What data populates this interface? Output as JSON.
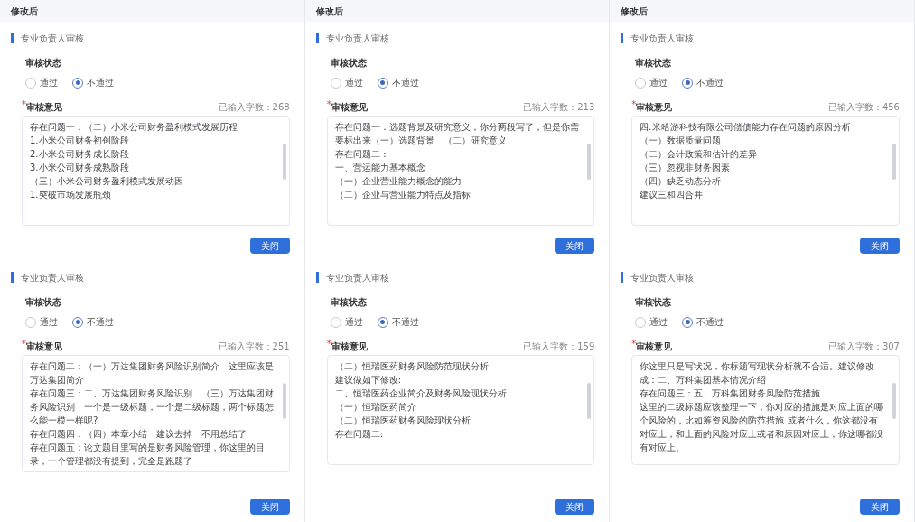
{
  "panels": [
    {
      "header": "修改后",
      "section": "专业负责人审核",
      "status_label": "审核状态",
      "options": [
        {
          "label": "通过",
          "selected": false
        },
        {
          "label": "不通过",
          "selected": true
        }
      ],
      "required_mark": "*",
      "opinion_label": "审核意见",
      "count": "已输入字数：268",
      "comment": [
        "存在问题一：（二）小米公司财务盈利模式发展历程",
        "1.小米公司财务初创阶段",
        "2.小米公司财务成长阶段",
        "3.小米公司财务成熟阶段",
        "（三）小米公司财务盈利模式发展动因",
        "1.突破市场发展瓶颈"
      ],
      "button": "关闭"
    },
    {
      "header": "修改后",
      "section": "专业负责人审核",
      "status_label": "审核状态",
      "options": [
        {
          "label": "通过",
          "selected": false
        },
        {
          "label": "不通过",
          "selected": true
        }
      ],
      "required_mark": "*",
      "opinion_label": "审核意见",
      "count": "已输入字数：213",
      "comment": [
        "存在问题一：选题背景及研究意义，你分两段写了，但是你需要标出来（一）选题背景　（二）研究意义",
        "存在问题二：",
        "一、营运能力基本概念",
        "（一）企业营业能力概念的能力",
        "（二）企业与营业能力特点及指标"
      ],
      "button": "关闭"
    },
    {
      "header": "修改后",
      "section": "专业负责人审核",
      "status_label": "审核状态",
      "options": [
        {
          "label": "通过",
          "selected": false
        },
        {
          "label": "不通过",
          "selected": true
        }
      ],
      "required_mark": "*",
      "opinion_label": "审核意见",
      "count": "已输入字数：456",
      "comment": [
        "四.米哈游科技有限公司偿债能力存在问题的原因分析",
        "（一）数据质量问题",
        "（二）会计政策和估计的差异",
        "（三）忽视非财务因素",
        "（四）缺乏动态分析",
        "建议三和四合并"
      ],
      "button": "关闭"
    },
    {
      "section": "专业负责人审核",
      "status_label": "审核状态",
      "options": [
        {
          "label": "通过",
          "selected": false
        },
        {
          "label": "不通过",
          "selected": true
        }
      ],
      "required_mark": "*",
      "opinion_label": "审核意见",
      "count": "已输入字数：251",
      "comment": [
        "存在问题二：（一）万达集团财务风险识别简介　这里应该是万达集团简介",
        "存在问题三：二、万达集团财务风险识别　（三）万达集团财务风险识别　一个是一级标题，一个是二级标题，两个标题怎么能一模一样呢?",
        "存在问题四：（四）本章小结　建议去掉　不用总结了",
        "存在问题五：论文题目里写的是财务风险管理，你这里的目录，一个管理都没有提到，完全是跑题了"
      ],
      "button": "关闭"
    },
    {
      "section": "专业负责人审核",
      "status_label": "审核状态",
      "options": [
        {
          "label": "通过",
          "selected": false
        },
        {
          "label": "不通过",
          "selected": true
        }
      ],
      "required_mark": "*",
      "opinion_label": "审核意见",
      "count": "已输入字数：159",
      "comment": [
        "（二）恒瑞医药财务风险防范现状分析",
        "建议做如下修改:",
        "二、恒瑞医药企业简介及财务风险现状分析",
        "（一）恒瑞医药简介",
        "（二）恒瑞医药财务风险现状分析",
        "存在问题二:"
      ],
      "button": "关闭"
    },
    {
      "section": "专业负责人审核",
      "status_label": "审核状态",
      "options": [
        {
          "label": "通过",
          "selected": false
        },
        {
          "label": "不通过",
          "selected": true
        }
      ],
      "required_mark": "*",
      "opinion_label": "审核意见",
      "count": "已输入字数：307",
      "comment": [
        "你这里只是写状况，你标题写现状分析就不合适。建议修改成：二、万科集团基本情况介绍",
        "存在问题三：五、万科集团财务风险防范措施",
        "这里的二级标题应该整理一下，你对应的措施是对应上面的哪个风险的，比如筹资风险的防范措施 或者什么，你这都没有对应上，和上面的风险对应上或者和原因对应上，你这哪都没有对应上。"
      ],
      "button": "关闭"
    }
  ]
}
